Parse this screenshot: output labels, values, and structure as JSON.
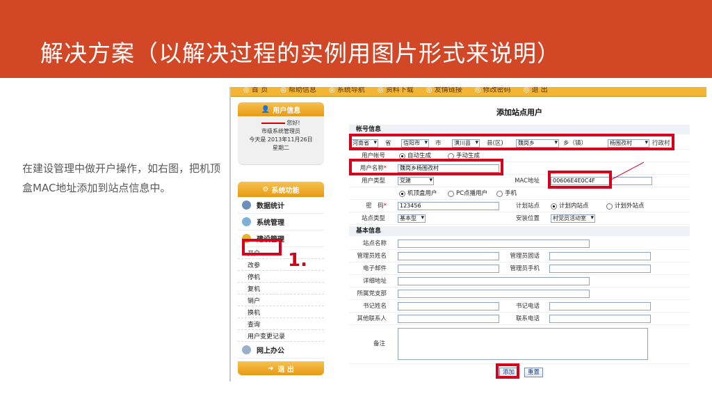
{
  "slide": {
    "title": "解决方案（以解决过程的实例用图片形式来说明）",
    "description": "在建设管理中做开户操作，如右图，把机顶盒MAC地址添加到站点信息中。",
    "annotation_number": "1."
  },
  "topnav": [
    "首 页",
    "帮助信息",
    "系统导航",
    "资料下载",
    "友情链接",
    "修改密码",
    "退 出"
  ],
  "sidebar": {
    "user_panel_title": "用户信息",
    "greeting": "您好!",
    "role": "市级系统管理员",
    "date": "今天是 2013年11月26日",
    "weekday": "星期二",
    "sys_panel_title": "系统功能",
    "menu": {
      "data_stats": "数据统计",
      "sys_manage": "系统管理",
      "build_manage": "建设管理",
      "online_office": "网上办公"
    },
    "sub_items": [
      "开户",
      "改参",
      "停机",
      "复机",
      "销户",
      "换机",
      "查询",
      "用户变更记录"
    ],
    "exit": "退 出"
  },
  "form": {
    "title": "添加站点用户",
    "account_section": "帐号信息",
    "province": "河南省",
    "province_suffix": "省",
    "city": "信阳市",
    "city_suffix": "市",
    "county": "潢川县",
    "county_suffix": "县(区)",
    "town": "魏岗乡",
    "town_suffix": "乡（镇）",
    "village": "杨围孜村",
    "village_suffix": "行政村",
    "account_label": "用户帐号",
    "auto_gen": "自动生成",
    "manual_gen": "手动生成",
    "username_label": "用户名称",
    "username_value": "魏岗乡杨围孜村",
    "usertype_label": "用户类型",
    "usertype_value": "党建",
    "mac_label": "MAC地址",
    "mac_value": "00606E4E0C4F",
    "opt_stb": "机顶盒用户",
    "opt_pc": "PC点播用户",
    "opt_phone": "手机",
    "password_label": "密　码",
    "password_value": "123456",
    "plan_site_label": "计划站点",
    "plan_in": "计划内站点",
    "plan_out": "计划外站点",
    "sitetype_label": "站点类型",
    "sitetype_value": "基本型",
    "install_label": "安装位置",
    "install_value": "村党员活动室",
    "basic_section": "基本信息",
    "site_name_label": "站点名称",
    "admin_name_label": "管理员姓名",
    "admin_phone_label": "管理员固话",
    "email_label": "电子邮件",
    "admin_mobile_label": "管理员手机",
    "address_label": "详细地址",
    "party_branch_label": "所属党支部",
    "secretary_name_label": "书记姓名",
    "secretary_phone_label": "书记电话",
    "other_contact_label": "其他联系人",
    "contact_phone_label": "联系电话",
    "remark_label": "备注",
    "add_button": "添加",
    "reset_button": "重置"
  },
  "colors": {
    "title_bar": "#d24726",
    "highlight": "#d6001c",
    "nav": "#f2b535"
  }
}
